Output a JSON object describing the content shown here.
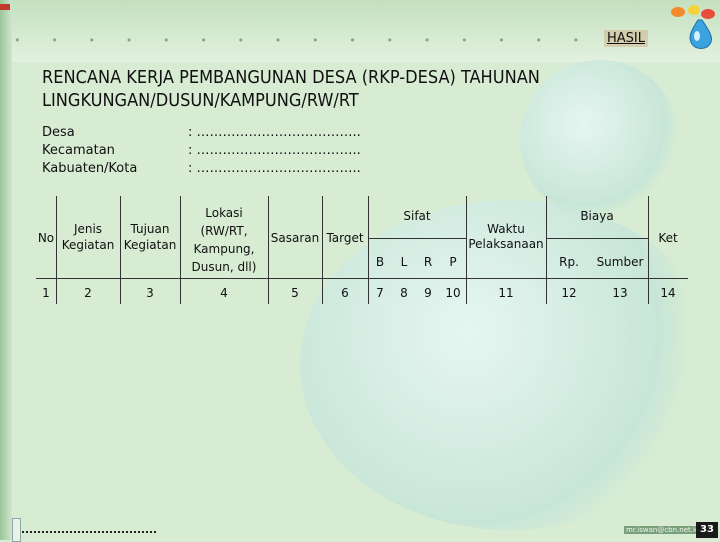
{
  "nav": {
    "hasil_link": "HASIL"
  },
  "title": {
    "line1": "RENCANA KERJA PEMBANGUNAN DESA (RKP-DESA) TAHUNAN",
    "line2": "LINGKUNGAN/DUSUN/KAMPUNG/RW/RT"
  },
  "info": [
    {
      "label": "Desa",
      "value": ": ……………………………….."
    },
    {
      "label": "Kecamatan",
      "value": ": ……………………………….."
    },
    {
      "label": "Kabuaten/Kota",
      "value": ": ……………………………….."
    }
  ],
  "table": {
    "headers": {
      "no": "No",
      "jenis": [
        "Jenis",
        "Kegiatan"
      ],
      "tujuan": [
        "Tujuan",
        "Kegiatan"
      ],
      "lokasi": [
        "Lokasi",
        "(RW/RT,",
        "Kampung,",
        "Dusun, dll)"
      ],
      "sasaran": "Sasaran",
      "target": "Target",
      "sifat": "Sifat",
      "sifat_sub": [
        "B",
        "L",
        "R",
        "P"
      ],
      "waktu": [
        "Waktu",
        "Pelaksanaan"
      ],
      "biaya": "Biaya",
      "biaya_sub": [
        "Rp.",
        "Sumber"
      ],
      "ket": "Ket"
    },
    "numbers": [
      "1",
      "2",
      "3",
      "4",
      "5",
      "6",
      "7",
      "8",
      "9",
      "10",
      "11",
      "12",
      "13",
      "14"
    ]
  },
  "footer": {
    "email": "mr.iswan@cbn.net.id",
    "page": "33"
  },
  "colors": {
    "background": "#d7ecd3",
    "accent": "#c0392b"
  }
}
